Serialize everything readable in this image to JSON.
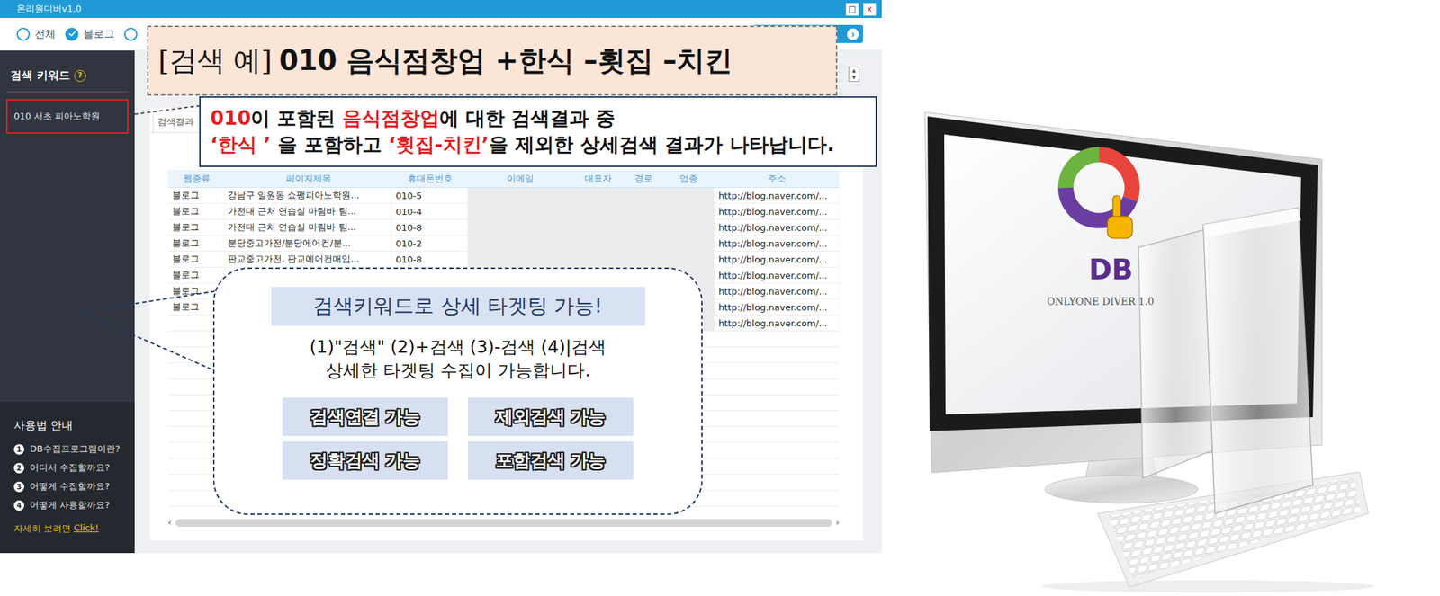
{
  "window": {
    "title": "온리원디버v1.0",
    "controls": [
      "□",
      "x"
    ]
  },
  "filters": [
    {
      "label": "전체",
      "selected": false
    },
    {
      "label": "블로그",
      "selected": true
    },
    {
      "label": "",
      "selected": false
    }
  ],
  "run_button": {
    "icon": "›"
  },
  "spinner": {
    "up": "▲",
    "down": "▼"
  },
  "sidebar": {
    "header": "검색 키워드",
    "help_icon": "?",
    "keywords": [
      {
        "label": "010 서초 피아노학원",
        "selected": true
      }
    ],
    "guide": {
      "title": "사용법 안내",
      "items": [
        {
          "number": "1",
          "label": "DB수집프로그램이란?"
        },
        {
          "number": "2",
          "label": "어디서 수집할까요?"
        },
        {
          "number": "3",
          "label": "어떻게 수집할까요?"
        },
        {
          "number": "4",
          "label": "어떻게 사용할까요?"
        }
      ],
      "more_prefix": "자세히 보려면",
      "more_link": "Click!"
    }
  },
  "tabs": [
    {
      "label": "검색결과",
      "selected": true
    }
  ],
  "table": {
    "columns": [
      {
        "label": "웹종류",
        "masked": false
      },
      {
        "label": "페이지제목",
        "masked": false
      },
      {
        "label": "휴대폰번호",
        "masked": false
      },
      {
        "label": "이메일",
        "masked": true
      },
      {
        "label": "대표자",
        "masked": true
      },
      {
        "label": "경로",
        "masked": true
      },
      {
        "label": "업종",
        "masked": true
      },
      {
        "label": "주소",
        "masked": false
      }
    ],
    "rows": [
      {
        "cells": [
          "블로그",
          "강남구 일원동 쇼팽피아노학원...",
          "010-5",
          "",
          "",
          "",
          "",
          "http://blog.naver.com/..."
        ]
      },
      {
        "cells": [
          "블로그",
          "가전대 근처 연습실 마림바 팀...",
          "010-4",
          "",
          "",
          "",
          "",
          "http://blog.naver.com/..."
        ]
      },
      {
        "cells": [
          "블로그",
          "가전대 근처 연습실 마림바 팀...",
          "010-8",
          "",
          "",
          "",
          "",
          "http://blog.naver.com/..."
        ]
      },
      {
        "cells": [
          "블로그",
          "분당중고가전/분당에어컨/분...",
          "010-2",
          "",
          "",
          "",
          "",
          "http://blog.naver.com/..."
        ]
      },
      {
        "cells": [
          "블로그",
          "판교중고가전, 판교에어컨매입...",
          "010-8",
          "",
          "",
          "",
          "",
          "http://blog.naver.com/..."
        ]
      },
      {
        "cells": [
          "블로그",
          "",
          "",
          "",
          "",
          "",
          "",
          "http://blog.naver.com/..."
        ]
      },
      {
        "cells": [
          "블로그",
          "",
          "",
          "",
          "",
          "",
          "",
          "http://blog.naver.com/..."
        ]
      },
      {
        "cells": [
          "블로그",
          "",
          "",
          "",
          "",
          "",
          "",
          "http://blog.naver.com/..."
        ]
      },
      {
        "cells": [
          "",
          "",
          "",
          "",
          "",
          "",
          "",
          "http://blog.naver.com/..."
        ]
      }
    ]
  },
  "scrollbar": {
    "left": "‹",
    "right": "›"
  },
  "callouts": {
    "example": {
      "prefix": "[검색 예]",
      "query": "010 음식점창업 +한식 –횟집 –치킨"
    },
    "explanation": {
      "lines": [
        [
          {
            "text": "010",
            "highlight": true
          },
          {
            "text": "이 포함된 ",
            "highlight": false
          },
          {
            "text": "음식점창업",
            "highlight": true
          },
          {
            "text": "에 대한 검색결과 중",
            "highlight": false
          }
        ],
        [
          {
            "text": "‘한식 ’",
            "highlight": true
          },
          {
            "text": " 을 포함하고 ",
            "highlight": false
          },
          {
            "text": "‘횟집-치킨’",
            "highlight": true
          },
          {
            "text": "을 제외한 상세검색 결과가 나타납니다.",
            "highlight": false
          }
        ]
      ]
    }
  },
  "feature_bubble": {
    "title": "검색키워드로 상세 타겟팅 가능!",
    "lines": [
      "(1)\"검색\" (2)+검색 (3)-검색 (4)|검색",
      "상세한 타겟팅 수집이 가능합니다."
    ],
    "badges": [
      "검색연결 가능",
      "제외검색 가능",
      "정확검색 가능",
      "포함검색 가능"
    ]
  },
  "product": {
    "logo_text": "DB",
    "caption": "ONLYONE DIVER 1.0"
  }
}
